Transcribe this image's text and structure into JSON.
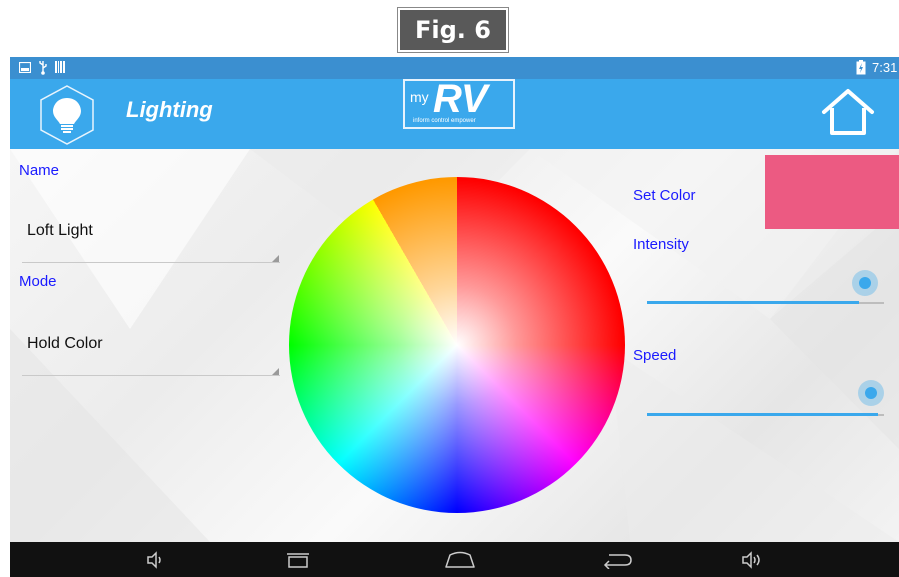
{
  "figure_label": "Fig. 6",
  "status_bar": {
    "time": "7:31"
  },
  "action_bar": {
    "title": "Lighting",
    "logo": {
      "brand_small": "my",
      "brand_large": "RV",
      "tagline": "inform control empower"
    }
  },
  "form": {
    "name_label": "Name",
    "name_value": "Loft Light",
    "mode_label": "Mode",
    "mode_value": "Hold Color"
  },
  "controls": {
    "set_color_label": "Set Color",
    "selected_color": "#ec5a82",
    "intensity_label": "Intensity",
    "intensity_level": 0.92,
    "speed_label": "Speed",
    "speed_level": 1.0
  },
  "colors": {
    "accent": "#3aa8ec",
    "label_blue": "#1a1aff"
  }
}
